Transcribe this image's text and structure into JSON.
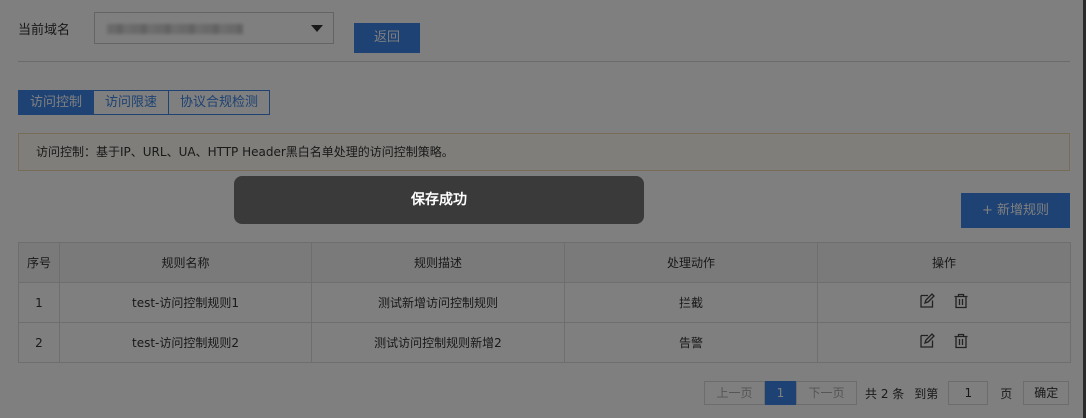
{
  "header": {
    "domain_label": "当前域名",
    "back_label": "返回"
  },
  "tabs": [
    {
      "label": "访问控制",
      "active": true
    },
    {
      "label": "访问限速",
      "active": false
    },
    {
      "label": "协议合规检测",
      "active": false
    }
  ],
  "notice": "访问控制：基于IP、URL、UA、HTTP Header黑白名单处理的访问控制策略。",
  "add_rule_label": "+ 新增规则",
  "table": {
    "columns": [
      "序号",
      "规则名称",
      "规则描述",
      "处理动作",
      "操作"
    ],
    "rows": [
      {
        "index": "1",
        "name": "test-访问控制规则1",
        "desc": "测试新增访问控制规则",
        "action": "拦截"
      },
      {
        "index": "2",
        "name": "test-访问控制规则2",
        "desc": "测试访问控制规则新增2",
        "action": "告警"
      }
    ],
    "op_icons": [
      "edit-icon",
      "delete-icon"
    ]
  },
  "pagination": {
    "prev": "上一页",
    "current": "1",
    "next": "下一页",
    "total": "共 2 条",
    "goto": "到第",
    "page_input": "1",
    "page_unit": "页",
    "confirm": "确定"
  },
  "toast": "保存成功",
  "colors": {
    "primary": "#3a84e6",
    "overlay": "rgba(0,0,0,0.5)",
    "toast_bg": "#3a3a3a"
  }
}
